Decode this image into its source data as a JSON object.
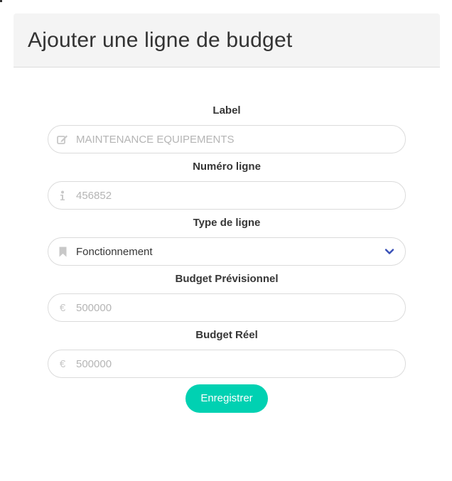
{
  "header": {
    "title": "Ajouter une ligne de budget"
  },
  "form": {
    "label": {
      "label": "Label",
      "placeholder": "MAINTENANCE EQUIPEMENTS",
      "value": "",
      "icon": "edit-icon"
    },
    "numero": {
      "label": "Numéro ligne",
      "placeholder": "456852",
      "value": "",
      "icon": "info-icon"
    },
    "type": {
      "label": "Type de ligne",
      "selected": "Fonctionnement",
      "icon": "bookmark-icon"
    },
    "previsionnel": {
      "label": "Budget Prévisionnel",
      "placeholder": "500000",
      "value": "",
      "icon": "euro-icon",
      "icon_glyph": "€"
    },
    "reel": {
      "label": "Budget Réel",
      "placeholder": "500000",
      "value": "",
      "icon": "euro-icon",
      "icon_glyph": "€"
    },
    "submit_label": "Enregistrer"
  },
  "colors": {
    "accent": "#00d1b2",
    "chevron": "#3850b7",
    "header_bg": "#f4f4f4"
  }
}
